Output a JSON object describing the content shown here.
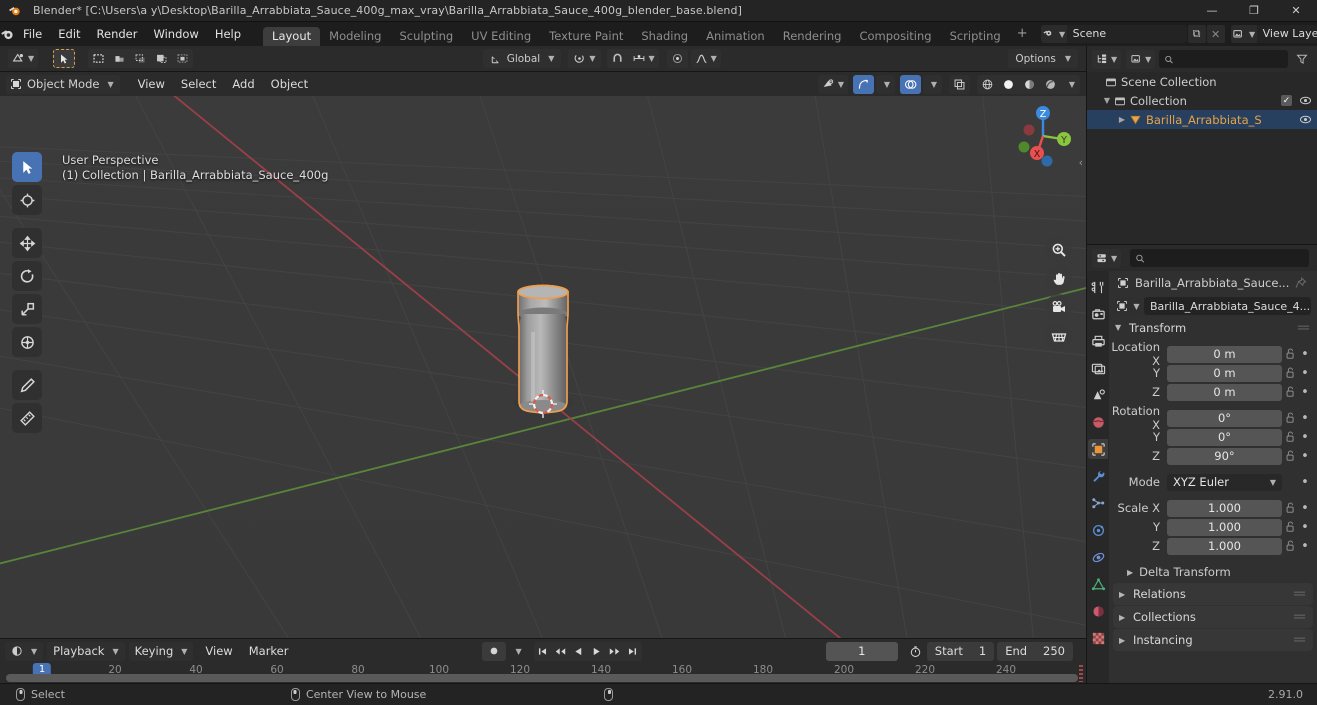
{
  "titlebar": {
    "app_icon": "blender-logo-icon",
    "title": "Blender* [C:\\Users\\a y\\Desktop\\Barilla_Arrabbiata_Sauce_400g_max_vray\\Barilla_Arrabbiata_Sauce_400g_blender_base.blend]",
    "minimize": "—",
    "maximize": "❐",
    "close": "✕"
  },
  "topbar": {
    "menus": [
      "File",
      "Edit",
      "Render",
      "Window",
      "Help"
    ],
    "workspaces": [
      {
        "label": "Layout",
        "active": true
      },
      {
        "label": "Modeling",
        "active": false
      },
      {
        "label": "Sculpting",
        "active": false
      },
      {
        "label": "UV Editing",
        "active": false
      },
      {
        "label": "Texture Paint",
        "active": false
      },
      {
        "label": "Shading",
        "active": false
      },
      {
        "label": "Animation",
        "active": false
      },
      {
        "label": "Rendering",
        "active": false
      },
      {
        "label": "Compositing",
        "active": false
      },
      {
        "label": "Scripting",
        "active": false
      }
    ],
    "add_workspace": "+",
    "scene": {
      "name": "Scene",
      "new_btn": "⧉",
      "unlink_btn": "✕"
    },
    "view_layer": {
      "name": "View Layer",
      "new_btn": "⧉",
      "unlink_btn": "✕"
    }
  },
  "viewport_tools_header": {
    "cursor_dropdown": "editor-type-icon",
    "select_tool": "tweak-select-icon",
    "select_modes": [
      "select-box-icon",
      "select-circle-icon",
      "select-lasso-icon",
      "select-extend-icon",
      "select-intersect-icon"
    ],
    "transform_orientation": "Global",
    "pivot_point": "pivot-point-icon",
    "snapping": "magnet-icon",
    "proportional_edit": "proportional-edit-icon",
    "proportional_falloff": "falloff-curve-icon",
    "options_label": "Options"
  },
  "viewport_header": {
    "mode": "Object Mode",
    "menus": [
      "View",
      "Select",
      "Add",
      "Object"
    ],
    "visibility": "show-hide-icon",
    "gizmo": "gizmo-icon",
    "overlays": "overlays-icon",
    "xray": "xray-icon",
    "shading_modes": [
      "wireframe-icon",
      "solid-icon",
      "material-preview-icon",
      "rendered-icon"
    ],
    "shading_active_index": 1
  },
  "viewport": {
    "overlay_line1": "User Perspective",
    "overlay_line2": "(1) Collection | Barilla_Arrabbiata_Sauce_400g",
    "toolbar": [
      {
        "name": "tweak-tool",
        "icon": "cursor-arrow-icon",
        "selected": true
      },
      {
        "name": "cursor-tool",
        "icon": "3d-cursor-icon",
        "selected": false
      },
      {
        "name": "move-tool",
        "icon": "move-arrows-icon",
        "selected": false
      },
      {
        "name": "rotate-tool",
        "icon": "rotate-icon",
        "selected": false
      },
      {
        "name": "scale-tool",
        "icon": "scale-icon",
        "selected": false
      },
      {
        "name": "transform-tool",
        "icon": "transform-icon",
        "selected": false
      },
      {
        "name": "annotate-tool",
        "icon": "pencil-icon",
        "selected": false
      },
      {
        "name": "measure-tool",
        "icon": "ruler-icon",
        "selected": false
      }
    ],
    "gizmo_axes": [
      {
        "label": "Z",
        "color": "#3c8ae0"
      },
      {
        "label": "Y",
        "color": "#8bc441"
      },
      {
        "label": "X",
        "color": "#e8504f"
      }
    ],
    "nav_buttons": [
      "zoom-icon",
      "hand-pan-icon",
      "camera-icon",
      "grid-ortho-icon"
    ],
    "object_name": "Barilla_Arrabbiata_Sauce_400g",
    "selection_outline_color": "#ed9e4f"
  },
  "outliner": {
    "display_mode_icon": "outliner-display-mode-icon",
    "filter_icon": "filter-icon",
    "search_placeholder": "",
    "search_value": "",
    "rows": [
      {
        "label": "Scene Collection",
        "icon": "scene-collection-icon",
        "depth": 0,
        "expandable": false,
        "selected": false,
        "checkbox": false,
        "eye": false
      },
      {
        "label": "Collection",
        "icon": "collection-icon",
        "depth": 1,
        "expandable": true,
        "selected": false,
        "checkbox": true,
        "eye": true
      },
      {
        "label": "Barilla_Arrabbiata_S",
        "icon": "mesh-object-icon",
        "depth": 2,
        "expandable": true,
        "selected": true,
        "checkbox": false,
        "eye": true
      }
    ]
  },
  "properties": {
    "editor_icon": "properties-editor-icon",
    "search_placeholder": "",
    "search_value": "",
    "tabs": [
      {
        "name": "tool-tab",
        "icon": "tool-icon",
        "active": false,
        "color": "#cfcfcf"
      },
      {
        "name": "render-tab",
        "icon": "camera-back-icon",
        "active": false,
        "color": "#cfcfcf"
      },
      {
        "name": "output-tab",
        "icon": "printer-icon",
        "active": false,
        "color": "#cfcfcf"
      },
      {
        "name": "view-layer-tab",
        "icon": "images-icon",
        "active": false,
        "color": "#cfcfcf"
      },
      {
        "name": "scene-tab",
        "icon": "scene-cone-icon",
        "active": false,
        "color": "#cfcfcf"
      },
      {
        "name": "world-tab",
        "icon": "world-globe-icon",
        "active": false,
        "color": "#d0606a"
      },
      {
        "name": "object-tab",
        "icon": "object-square-icon",
        "active": true,
        "color": "#e8943a"
      },
      {
        "name": "modifier-tab",
        "icon": "wrench-icon",
        "active": false,
        "color": "#5b8fd4"
      },
      {
        "name": "particles-tab",
        "icon": "particles-icon",
        "active": false,
        "color": "#8ba7cf"
      },
      {
        "name": "physics-tab",
        "icon": "physics-orbit-icon",
        "active": false,
        "color": "#5b8fd4"
      },
      {
        "name": "constraints-tab",
        "icon": "constraint-icon",
        "active": false,
        "color": "#6f8fd4"
      },
      {
        "name": "data-tab",
        "icon": "mesh-data-triangle-icon",
        "active": false,
        "color": "#4cb07a"
      },
      {
        "name": "material-tab",
        "icon": "material-sphere-icon",
        "active": false,
        "color": "#cc5a6e"
      },
      {
        "name": "texture-tab",
        "icon": "checker-texture-icon",
        "active": false,
        "color": "#cc5a5a"
      }
    ],
    "breadcrumb_object": "Barilla_Arrabbiata_Sauce...",
    "pin_icon": "pin-icon",
    "object_field": "Barilla_Arrabbiata_Sauce_4...",
    "transform": {
      "title": "Transform",
      "open": true,
      "fields": [
        {
          "label": "Location X",
          "value": "0 m"
        },
        {
          "label": "Y",
          "value": "0 m"
        },
        {
          "label": "Z",
          "value": "0 m"
        },
        {
          "label": "Rotation X",
          "value": "0°"
        },
        {
          "label": "Y",
          "value": "0°"
        },
        {
          "label": "Z",
          "value": "90°"
        }
      ],
      "mode_label": "Mode",
      "mode_value": "XYZ Euler",
      "scale_fields": [
        {
          "label": "Scale X",
          "value": "1.000"
        },
        {
          "label": "Y",
          "value": "1.000"
        },
        {
          "label": "Z",
          "value": "1.000"
        }
      ],
      "delta_transform": "Delta Transform"
    },
    "closed_panels": [
      "Relations",
      "Collections",
      "Instancing"
    ]
  },
  "timeline": {
    "editor_icon": "timeline-editor-icon",
    "menus_dropdown": [
      "Playback",
      "Keying"
    ],
    "menus_plain": [
      "View",
      "Marker"
    ],
    "record_icon": "record-keyframe-icon",
    "playback_buttons": [
      "jump-to-start-icon",
      "prev-keyframe-icon",
      "play-reverse-icon",
      "play-icon",
      "next-keyframe-icon",
      "jump-to-end-icon"
    ],
    "current_frame": "1",
    "frame_range_icon": "stopwatch-icon",
    "start_label": "Start",
    "start_value": "1",
    "end_label": "End",
    "end_value": "250",
    "playhead_frame": "1",
    "ruler_ticks": [
      "20",
      "40",
      "60",
      "80",
      "100",
      "120",
      "140",
      "160",
      "180",
      "200",
      "220",
      "240"
    ]
  },
  "statusbar": {
    "items": [
      {
        "icon": "mouse-left-icon",
        "label": "Select"
      },
      {
        "icon": "mouse-middle-icon",
        "label": "Center View to Mouse"
      },
      {
        "icon": "mouse-right-icon",
        "label": ""
      }
    ],
    "version": "2.91.0"
  },
  "colors": {
    "accent": "#4772b3",
    "select_outline": "#ed9e4f",
    "panel_bg": "#303030",
    "header_bg": "#2b2b2b",
    "viewport_bg": "#393939"
  }
}
